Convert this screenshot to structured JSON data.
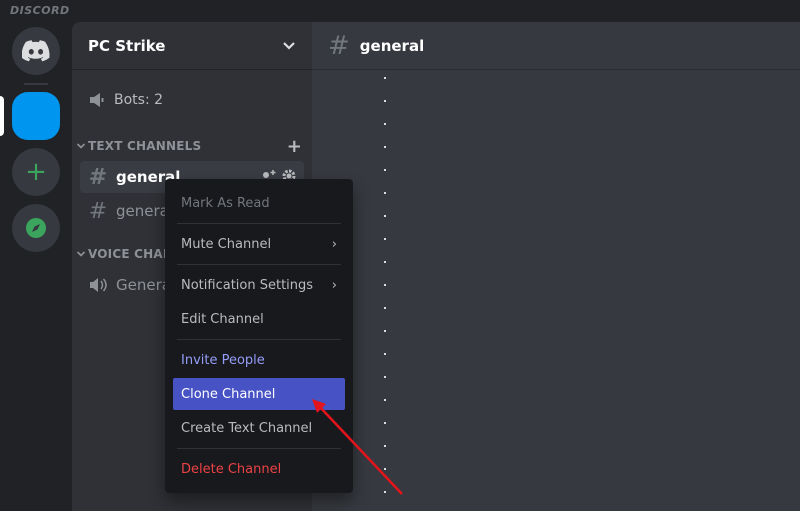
{
  "app": {
    "wordmark": "DISCORD"
  },
  "server": {
    "name": "PC Strike",
    "bots_label": "Bots: 2"
  },
  "categories": {
    "text": "TEXT CHANNELS",
    "voice": "VOICE CHANNELS"
  },
  "channels": {
    "text": [
      {
        "name": "general"
      },
      {
        "name": "general"
      }
    ],
    "voice": [
      {
        "name": "General"
      }
    ]
  },
  "main": {
    "title": "general"
  },
  "context_menu": {
    "items": [
      {
        "label": "Mark As Read"
      },
      {
        "label": "Mute Channel"
      },
      {
        "label": "Notification Settings"
      },
      {
        "label": "Edit Channel"
      },
      {
        "label": "Invite People"
      },
      {
        "label": "Clone Channel"
      },
      {
        "label": "Create Text Channel"
      },
      {
        "label": "Delete Channel"
      }
    ],
    "highlighted": "Clone Channel"
  },
  "colors": {
    "accent": "#4752c4",
    "danger": "#ed4245",
    "invite": "#949cf7",
    "server_active": "#0096ef",
    "annotation_arrow": "#e3141b"
  }
}
